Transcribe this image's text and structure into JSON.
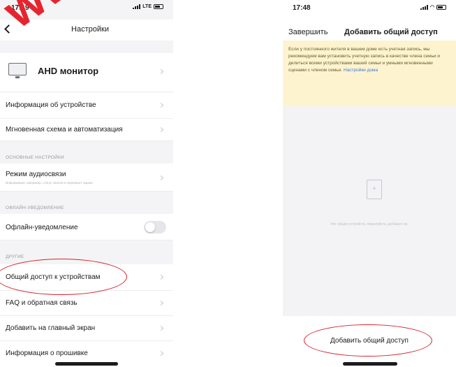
{
  "left_screen": {
    "status": {
      "time": "17:19",
      "network": "LTE"
    },
    "nav": {
      "title": "Настройки"
    },
    "device": {
      "name": "AHD монитор"
    },
    "rows": {
      "device_info": "Информация об устройстве",
      "scenes": "Мгновенная схема и автоматизация"
    },
    "basic_settings": {
      "header": "ОСНОВНЫЕ НАСТРОЙКИ",
      "audio_mode": "Режим аудиосвязи",
      "audio_mode_sub": "Информация, например, статус панели и переворот экрана"
    },
    "offline": {
      "header": "ОФЛАЙН-УВЕДОМЛЕНИЕ",
      "label": "Офлайн-уведомление",
      "enabled": false
    },
    "other": {
      "header": "ДРУГИЕ",
      "sharing": "Общий доступ к устройствам",
      "faq": "FAQ и обратная связь",
      "home_screen": "Добавить на главный экран",
      "firmware": "Информация о прошивке"
    }
  },
  "right_screen": {
    "status": {
      "time": "17:48"
    },
    "header": {
      "finish": "Завершить",
      "title": "Добавить общий доступ"
    },
    "notice": {
      "text": "Если у постоянного жителя в вашем доме есть учетная запись, мы рекомендуем вам установить учетную запись в качестве члена семьи и делиться всеми устройствами вашей семьи и умными мгновенными сценами с членом семьи.",
      "link": "Настройки дома"
    },
    "empty_message": "Нет общих устройств, пожалуйста, добавьте их.",
    "add_button": "Добавить общий доступ"
  },
  "watermark": "www.bez",
  "colors": {
    "annotation": "#d2222d",
    "notice_bg": "#fdf3cf",
    "link": "#3a7bd5",
    "watermark": "#e6242e"
  }
}
